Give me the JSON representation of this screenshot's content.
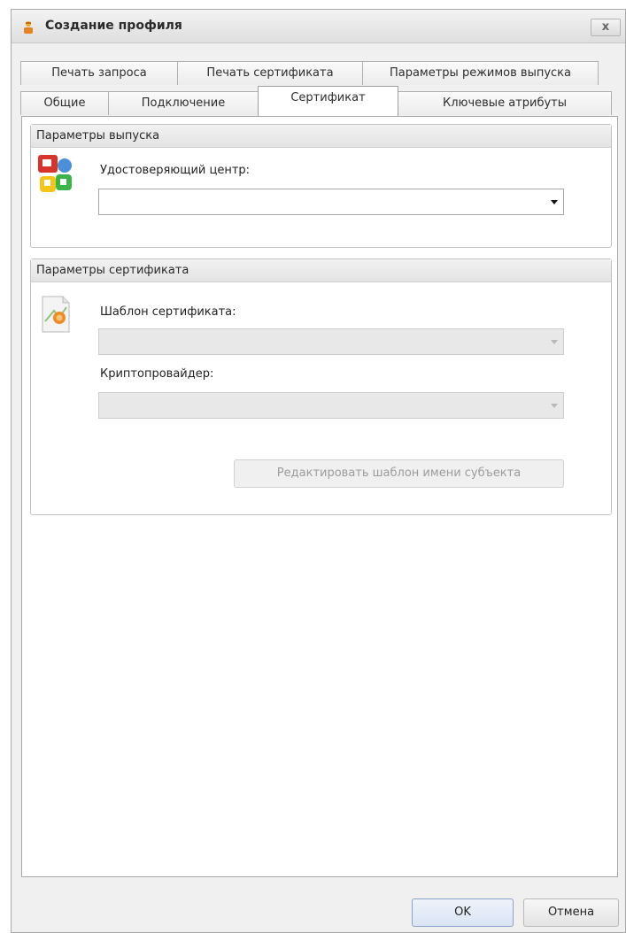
{
  "window": {
    "title": "Создание профиля",
    "close_label": "x"
  },
  "tabs": {
    "row1": [
      "Печать запроса",
      "Печать сертификата",
      "Параметры режимов выпуска"
    ],
    "row2": [
      "Общие",
      "Подключение",
      "Сертификат",
      "Ключевые атрибуты"
    ],
    "active": "Сертификат"
  },
  "issue_params": {
    "header": "Параметры выпуска",
    "ca_label": "Удостоверяющий центр:",
    "ca_value": ""
  },
  "cert_params": {
    "header": "Параметры сертификата",
    "template_label": "Шаблон сертификата:",
    "template_value": "",
    "csp_label": "Криптопровайдер:",
    "csp_value": "",
    "edit_subject_button": "Редактировать шаблон имени субъекта"
  },
  "footer": {
    "ok_label": "OK",
    "cancel_label": "Отмена"
  }
}
